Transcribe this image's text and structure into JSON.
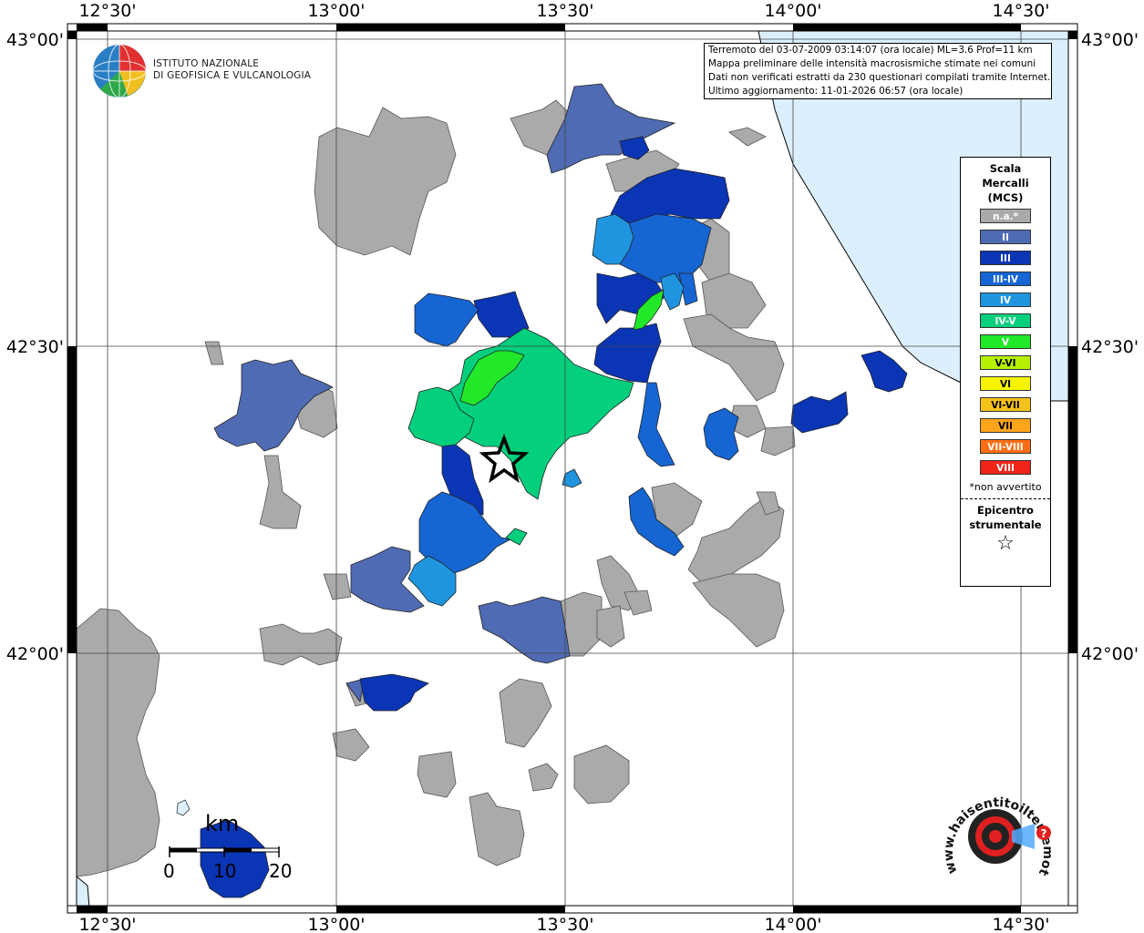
{
  "map": {
    "title": "Intensità macrosismiche stimate",
    "lon_labels": [
      "12°30'",
      "13°00'",
      "13°30'",
      "14°00'",
      "14°30'"
    ],
    "lat_labels": [
      "43°00'",
      "42°30'",
      "42°00'"
    ],
    "colors": {
      "sea": "#dcefff",
      "na": "#aaaaaa",
      "II": "#4f6bb3",
      "III": "#0a35b5",
      "III-IV": "#1565d3",
      "IV": "#1f95df",
      "IV-V": "#04cf7c",
      "V": "#22e82a",
      "V-VI": "#b5f000",
      "VI": "#f5f500",
      "VI-VII": "#f5c21a",
      "VII": "#ffa51a",
      "VII-VIII": "#ff6e14",
      "VIII": "#f02419"
    }
  },
  "info_box": {
    "line1": "Terremoto del 03-07-2009 03:14:07 (ora locale) ML=3.6 Prof=11 km",
    "line2": "Mappa preliminare delle intensità macrosismiche stimate nei comuni",
    "line3": "Dati non verificati estratti da 230 questionari compilati tramite Internet.",
    "line4": "Ultimo aggiornamento: 11-01-2026 06:57 (ora locale)"
  },
  "logo": {
    "line1": "ISTITUTO NAZIONALE",
    "line2": "DI GEOFISICA E VULCANOLOGIA"
  },
  "legend": {
    "title": "Scala\nMercalli\n(MCS)",
    "items": [
      {
        "label": "n.a.*",
        "color": "#aaaaaa"
      },
      {
        "label": "II",
        "color": "#4f6bb3"
      },
      {
        "label": "III",
        "color": "#0a35b5"
      },
      {
        "label": "III-IV",
        "color": "#1565d3"
      },
      {
        "label": "IV",
        "color": "#1f95df"
      },
      {
        "label": "IV-V",
        "color": "#04cf7c"
      },
      {
        "label": "V",
        "color": "#22e82a"
      },
      {
        "label": "V-VI",
        "color": "#b5f000"
      },
      {
        "label": "VI",
        "color": "#f5f500"
      },
      {
        "label": "VI-VII",
        "color": "#f5c21a"
      },
      {
        "label": "VII",
        "color": "#ffa51a"
      },
      {
        "label": "VII-VIII",
        "color": "#ff6e14"
      },
      {
        "label": "VIII",
        "color": "#f02419"
      }
    ],
    "note": "*non avvertito",
    "epicenter_title": "Epicentro\nstrumentale",
    "epicenter_symbol": "☆"
  },
  "scale_bar": {
    "unit": "km",
    "ticks": [
      "0",
      "10",
      "20"
    ]
  },
  "haisentito": {
    "text": "www.haisentitoilterremoto.it"
  }
}
